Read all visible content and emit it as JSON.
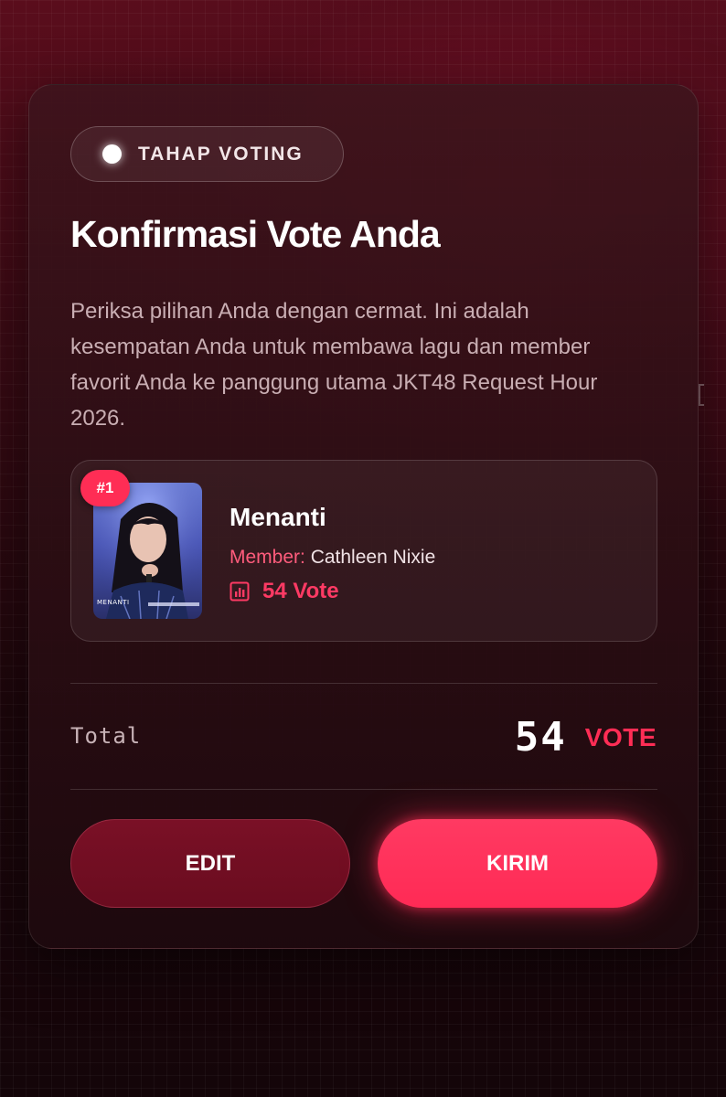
{
  "badge": {
    "label": "TAHAP VOTING"
  },
  "title": "Konfirmasi Vote Anda",
  "description": "Periksa pilihan Anda dengan cermat. Ini adalah kesempatan Anda untuk membawa lagu dan member favorit Anda ke panggung utama JKT48 Request Hour 2026.",
  "selection": {
    "rank": "#1",
    "thumbnail_caption": "MENANTI",
    "song_title": "Menanti",
    "member_label": "Member:",
    "member_name": "Cathleen Nixie",
    "vote_text": "54 Vote",
    "vote_icon": "bar-chart-icon"
  },
  "summary": {
    "total_label": "Total",
    "total_number": "54",
    "total_unit": "VOTE"
  },
  "actions": {
    "edit_label": "EDIT",
    "send_label": "KIRIM"
  },
  "colors": {
    "accent": "#ff2d55",
    "edit_button": "#6e0d22",
    "card_background": "#2e0d14"
  }
}
